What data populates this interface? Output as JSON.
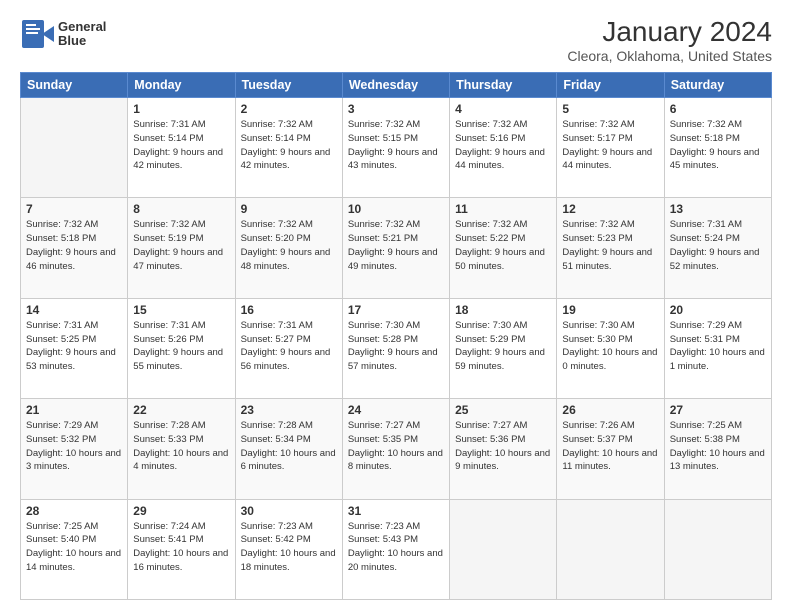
{
  "logo": {
    "line1": "General",
    "line2": "Blue"
  },
  "title": "January 2024",
  "subtitle": "Cleora, Oklahoma, United States",
  "days_header": [
    "Sunday",
    "Monday",
    "Tuesday",
    "Wednesday",
    "Thursday",
    "Friday",
    "Saturday"
  ],
  "weeks": [
    [
      {
        "day": "",
        "sunrise": "",
        "sunset": "",
        "daylight": ""
      },
      {
        "day": "1",
        "sunrise": "Sunrise: 7:31 AM",
        "sunset": "Sunset: 5:14 PM",
        "daylight": "Daylight: 9 hours and 42 minutes."
      },
      {
        "day": "2",
        "sunrise": "Sunrise: 7:32 AM",
        "sunset": "Sunset: 5:14 PM",
        "daylight": "Daylight: 9 hours and 42 minutes."
      },
      {
        "day": "3",
        "sunrise": "Sunrise: 7:32 AM",
        "sunset": "Sunset: 5:15 PM",
        "daylight": "Daylight: 9 hours and 43 minutes."
      },
      {
        "day": "4",
        "sunrise": "Sunrise: 7:32 AM",
        "sunset": "Sunset: 5:16 PM",
        "daylight": "Daylight: 9 hours and 44 minutes."
      },
      {
        "day": "5",
        "sunrise": "Sunrise: 7:32 AM",
        "sunset": "Sunset: 5:17 PM",
        "daylight": "Daylight: 9 hours and 44 minutes."
      },
      {
        "day": "6",
        "sunrise": "Sunrise: 7:32 AM",
        "sunset": "Sunset: 5:18 PM",
        "daylight": "Daylight: 9 hours and 45 minutes."
      }
    ],
    [
      {
        "day": "7",
        "sunrise": "Sunrise: 7:32 AM",
        "sunset": "Sunset: 5:18 PM",
        "daylight": "Daylight: 9 hours and 46 minutes."
      },
      {
        "day": "8",
        "sunrise": "Sunrise: 7:32 AM",
        "sunset": "Sunset: 5:19 PM",
        "daylight": "Daylight: 9 hours and 47 minutes."
      },
      {
        "day": "9",
        "sunrise": "Sunrise: 7:32 AM",
        "sunset": "Sunset: 5:20 PM",
        "daylight": "Daylight: 9 hours and 48 minutes."
      },
      {
        "day": "10",
        "sunrise": "Sunrise: 7:32 AM",
        "sunset": "Sunset: 5:21 PM",
        "daylight": "Daylight: 9 hours and 49 minutes."
      },
      {
        "day": "11",
        "sunrise": "Sunrise: 7:32 AM",
        "sunset": "Sunset: 5:22 PM",
        "daylight": "Daylight: 9 hours and 50 minutes."
      },
      {
        "day": "12",
        "sunrise": "Sunrise: 7:32 AM",
        "sunset": "Sunset: 5:23 PM",
        "daylight": "Daylight: 9 hours and 51 minutes."
      },
      {
        "day": "13",
        "sunrise": "Sunrise: 7:31 AM",
        "sunset": "Sunset: 5:24 PM",
        "daylight": "Daylight: 9 hours and 52 minutes."
      }
    ],
    [
      {
        "day": "14",
        "sunrise": "Sunrise: 7:31 AM",
        "sunset": "Sunset: 5:25 PM",
        "daylight": "Daylight: 9 hours and 53 minutes."
      },
      {
        "day": "15",
        "sunrise": "Sunrise: 7:31 AM",
        "sunset": "Sunset: 5:26 PM",
        "daylight": "Daylight: 9 hours and 55 minutes."
      },
      {
        "day": "16",
        "sunrise": "Sunrise: 7:31 AM",
        "sunset": "Sunset: 5:27 PM",
        "daylight": "Daylight: 9 hours and 56 minutes."
      },
      {
        "day": "17",
        "sunrise": "Sunrise: 7:30 AM",
        "sunset": "Sunset: 5:28 PM",
        "daylight": "Daylight: 9 hours and 57 minutes."
      },
      {
        "day": "18",
        "sunrise": "Sunrise: 7:30 AM",
        "sunset": "Sunset: 5:29 PM",
        "daylight": "Daylight: 9 hours and 59 minutes."
      },
      {
        "day": "19",
        "sunrise": "Sunrise: 7:30 AM",
        "sunset": "Sunset: 5:30 PM",
        "daylight": "Daylight: 10 hours and 0 minutes."
      },
      {
        "day": "20",
        "sunrise": "Sunrise: 7:29 AM",
        "sunset": "Sunset: 5:31 PM",
        "daylight": "Daylight: 10 hours and 1 minute."
      }
    ],
    [
      {
        "day": "21",
        "sunrise": "Sunrise: 7:29 AM",
        "sunset": "Sunset: 5:32 PM",
        "daylight": "Daylight: 10 hours and 3 minutes."
      },
      {
        "day": "22",
        "sunrise": "Sunrise: 7:28 AM",
        "sunset": "Sunset: 5:33 PM",
        "daylight": "Daylight: 10 hours and 4 minutes."
      },
      {
        "day": "23",
        "sunrise": "Sunrise: 7:28 AM",
        "sunset": "Sunset: 5:34 PM",
        "daylight": "Daylight: 10 hours and 6 minutes."
      },
      {
        "day": "24",
        "sunrise": "Sunrise: 7:27 AM",
        "sunset": "Sunset: 5:35 PM",
        "daylight": "Daylight: 10 hours and 8 minutes."
      },
      {
        "day": "25",
        "sunrise": "Sunrise: 7:27 AM",
        "sunset": "Sunset: 5:36 PM",
        "daylight": "Daylight: 10 hours and 9 minutes."
      },
      {
        "day": "26",
        "sunrise": "Sunrise: 7:26 AM",
        "sunset": "Sunset: 5:37 PM",
        "daylight": "Daylight: 10 hours and 11 minutes."
      },
      {
        "day": "27",
        "sunrise": "Sunrise: 7:25 AM",
        "sunset": "Sunset: 5:38 PM",
        "daylight": "Daylight: 10 hours and 13 minutes."
      }
    ],
    [
      {
        "day": "28",
        "sunrise": "Sunrise: 7:25 AM",
        "sunset": "Sunset: 5:40 PM",
        "daylight": "Daylight: 10 hours and 14 minutes."
      },
      {
        "day": "29",
        "sunrise": "Sunrise: 7:24 AM",
        "sunset": "Sunset: 5:41 PM",
        "daylight": "Daylight: 10 hours and 16 minutes."
      },
      {
        "day": "30",
        "sunrise": "Sunrise: 7:23 AM",
        "sunset": "Sunset: 5:42 PM",
        "daylight": "Daylight: 10 hours and 18 minutes."
      },
      {
        "day": "31",
        "sunrise": "Sunrise: 7:23 AM",
        "sunset": "Sunset: 5:43 PM",
        "daylight": "Daylight: 10 hours and 20 minutes."
      },
      {
        "day": "",
        "sunrise": "",
        "sunset": "",
        "daylight": ""
      },
      {
        "day": "",
        "sunrise": "",
        "sunset": "",
        "daylight": ""
      },
      {
        "day": "",
        "sunrise": "",
        "sunset": "",
        "daylight": ""
      }
    ]
  ]
}
